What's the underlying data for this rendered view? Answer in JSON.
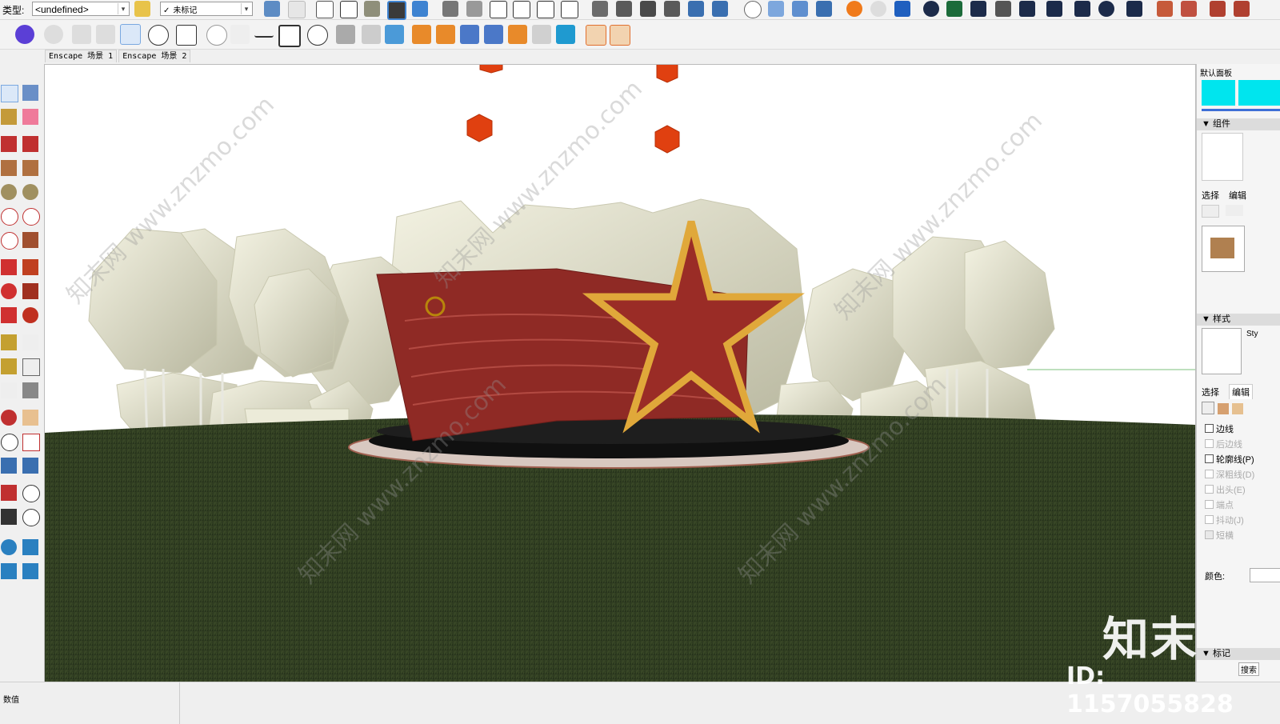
{
  "toolbar": {
    "type_label": "类型:",
    "type_value": "<undefined>",
    "tag_value": "未标记",
    "tag_check": "✓"
  },
  "scene_tabs": [
    "Enscape 场景 1",
    "Enscape 场景 2"
  ],
  "right_panel": {
    "default_panel": "默认面板",
    "components_header": "▼ 组件",
    "select_tab": "选择",
    "edit_tab": "编辑",
    "styles_header": "▼ 样式",
    "style_select_tab": "选择",
    "style_edit_tab": "编辑",
    "style_cut": "Sty",
    "edge_settings": [
      {
        "label": "边线",
        "enabled": true,
        "checked": false
      },
      {
        "label": "后边线",
        "enabled": false,
        "checked": false
      },
      {
        "label": "轮廓线(P)",
        "enabled": true,
        "checked": false
      },
      {
        "label": "深粗线(D)",
        "enabled": false,
        "checked": false
      },
      {
        "label": "出头(E)",
        "enabled": false,
        "checked": false
      },
      {
        "label": "端点",
        "enabled": false,
        "checked": false
      },
      {
        "label": "抖动(J)",
        "enabled": false,
        "checked": false
      },
      {
        "label": "短横",
        "enabled": false,
        "checked": true
      }
    ],
    "color_label": "颜色:",
    "tags_header": "▼ 标记",
    "search_cut": "搜索"
  },
  "status_bar": {
    "label": "数值"
  },
  "watermark": {
    "logo": "知末",
    "id": "ID: 1157055828",
    "diag": "知末网 www.znzmo.com"
  },
  "colors": {
    "sky": "#ffffff",
    "grass": "#2f3d1f",
    "flag_red": "#8f2a25",
    "star_gold": "#e0a83a",
    "tree": "#e9e8d4",
    "accent_cyan": "#00e5ee"
  }
}
